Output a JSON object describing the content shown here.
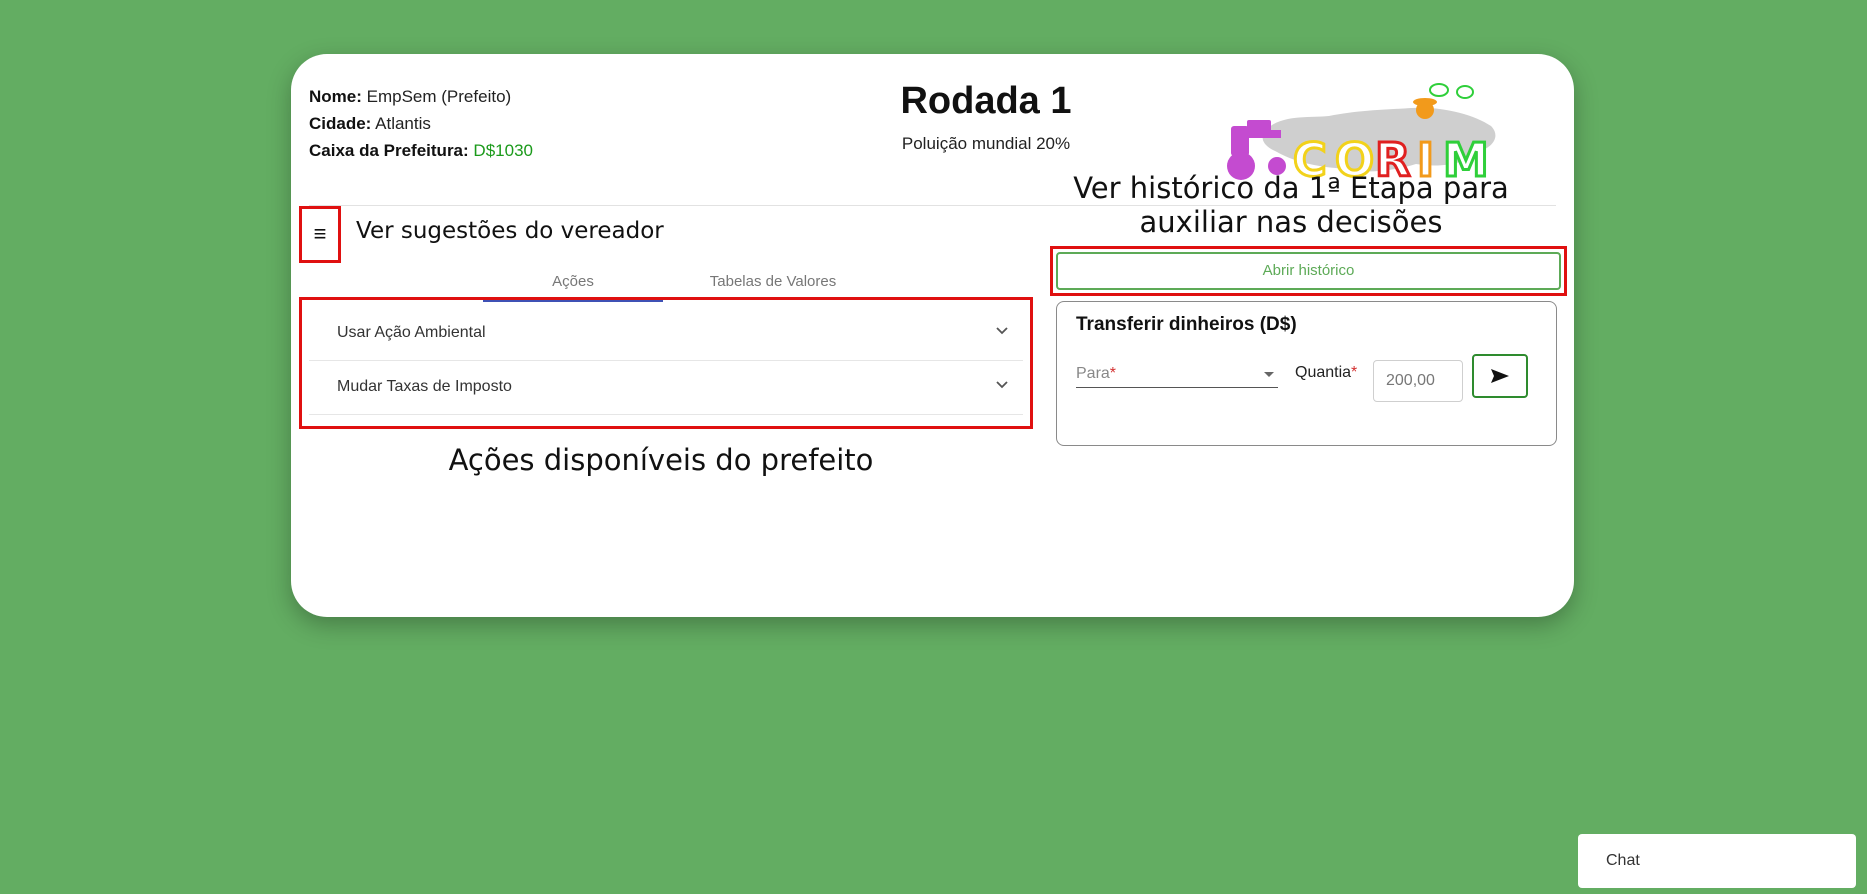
{
  "player": {
    "name_label": "Nome:",
    "name_value": "EmpSem (Prefeito)",
    "city_label": "Cidade:",
    "city_value": "Atlantis",
    "cash_label": "Caixa da Prefeitura:",
    "cash_value": "D$1030"
  },
  "round": {
    "title": "Rodada 1",
    "pollution": "Poluição mundial 20%"
  },
  "logo": {
    "letters": [
      "C",
      "O",
      "R",
      "I",
      "M"
    ]
  },
  "annotations": {
    "history": "Ver histórico da 1ª Etapa para auxiliar nas decisões",
    "suggestions": "Ver sugestões do vereador",
    "actions": "Ações disponíveis do prefeito"
  },
  "menu": {
    "icon": "≡"
  },
  "tabs": [
    {
      "label": "Ações"
    },
    {
      "label": "Tabelas de Valores"
    }
  ],
  "accordion": [
    {
      "label": "Usar Ação Ambiental"
    },
    {
      "label": "Mudar Taxas de Imposto"
    }
  ],
  "history_button": {
    "label": "Abrir histórico"
  },
  "transfer": {
    "title": "Transferir dinheiros (D$)",
    "to_label": "Para",
    "required_mark": "*",
    "amount_label": "Quantia",
    "amount_placeholder": "200,00"
  },
  "chat": {
    "label": "Chat"
  },
  "colors": {
    "background": "#63ad62",
    "money": "#1b9a1b",
    "highlight": "#e01010",
    "accent": "#5daa57"
  }
}
